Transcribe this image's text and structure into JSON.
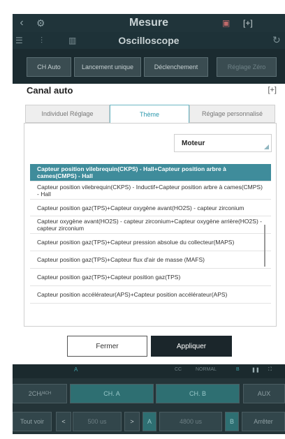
{
  "app": {
    "window_title": "Mesure",
    "subtitle": "Oscilloscope",
    "icons": [
      "back-icon",
      "gear-icon",
      "record-icon",
      "expand-icon",
      "refresh-icon"
    ],
    "toolbar": {
      "buttons": [
        {
          "label": "CH Auto"
        },
        {
          "label": "Lancement unique"
        },
        {
          "label": "Déclenchement"
        },
        {
          "label": "Réglage Zéro"
        }
      ]
    },
    "bottom": {
      "status": {
        "channel": "A",
        "cc_label": "CC",
        "mode": "NORMAL",
        "channel_b": "B"
      },
      "row1": {
        "ch_mode": "2CH/",
        "ch_mode_sub": "4CH",
        "ch_a": "CH. A",
        "ch_b": "CH. B",
        "aux": "AUX"
      },
      "row2": {
        "tout_voir": "Tout voir",
        "prev": "<",
        "time1": "500 us",
        "next": ">",
        "a_label": "A",
        "time2": "4800 us",
        "b_label": "B",
        "stop": "Arrêter"
      }
    }
  },
  "dialog": {
    "title": "Canal auto",
    "tabs": [
      {
        "label": "Individuel Réglage",
        "active": false
      },
      {
        "label": "Thème",
        "active": true
      },
      {
        "label": "Réglage personnalisé",
        "active": false
      }
    ],
    "dropdown": {
      "value": "Moteur"
    },
    "items": [
      {
        "label": "Capteur position vilebrequin(CKPS) - Hall+Capteur position arbre à cames(CMPS) - Hall",
        "selected": true
      },
      {
        "label": "Capteur position vilebrequin(CKPS) - Inductif+Capteur position arbre à cames(CMPS) - Hall",
        "selected": false
      },
      {
        "label": "Capteur position gaz(TPS)+Capteur oxygène avant(HO2S) - capteur zirconium",
        "selected": false
      },
      {
        "label": "Capteur oxygène avant(HO2S) - capteur zirconium+Capteur oxygène arrière(HO2S) - capteur zirconium",
        "selected": false
      },
      {
        "label": "Capteur position gaz(TPS)+Capteur pression absolue du collecteur(MAPS)",
        "selected": false
      },
      {
        "label": "Capteur position gaz(TPS)+Capteur flux d'air de masse (MAFS)",
        "selected": false
      },
      {
        "label": "Capteur position gaz(TPS)+Capteur position gaz(TPS)",
        "selected": false
      },
      {
        "label": "Capteur position accélérateur(APS)+Capteur position accélérateur(APS)",
        "selected": false
      }
    ],
    "buttons": {
      "close": "Fermer",
      "apply": "Appliquer"
    }
  },
  "colors": {
    "accent": "#2b98ad",
    "selected_row": "#3f8c9b",
    "apply_bg": "#1b262b"
  }
}
